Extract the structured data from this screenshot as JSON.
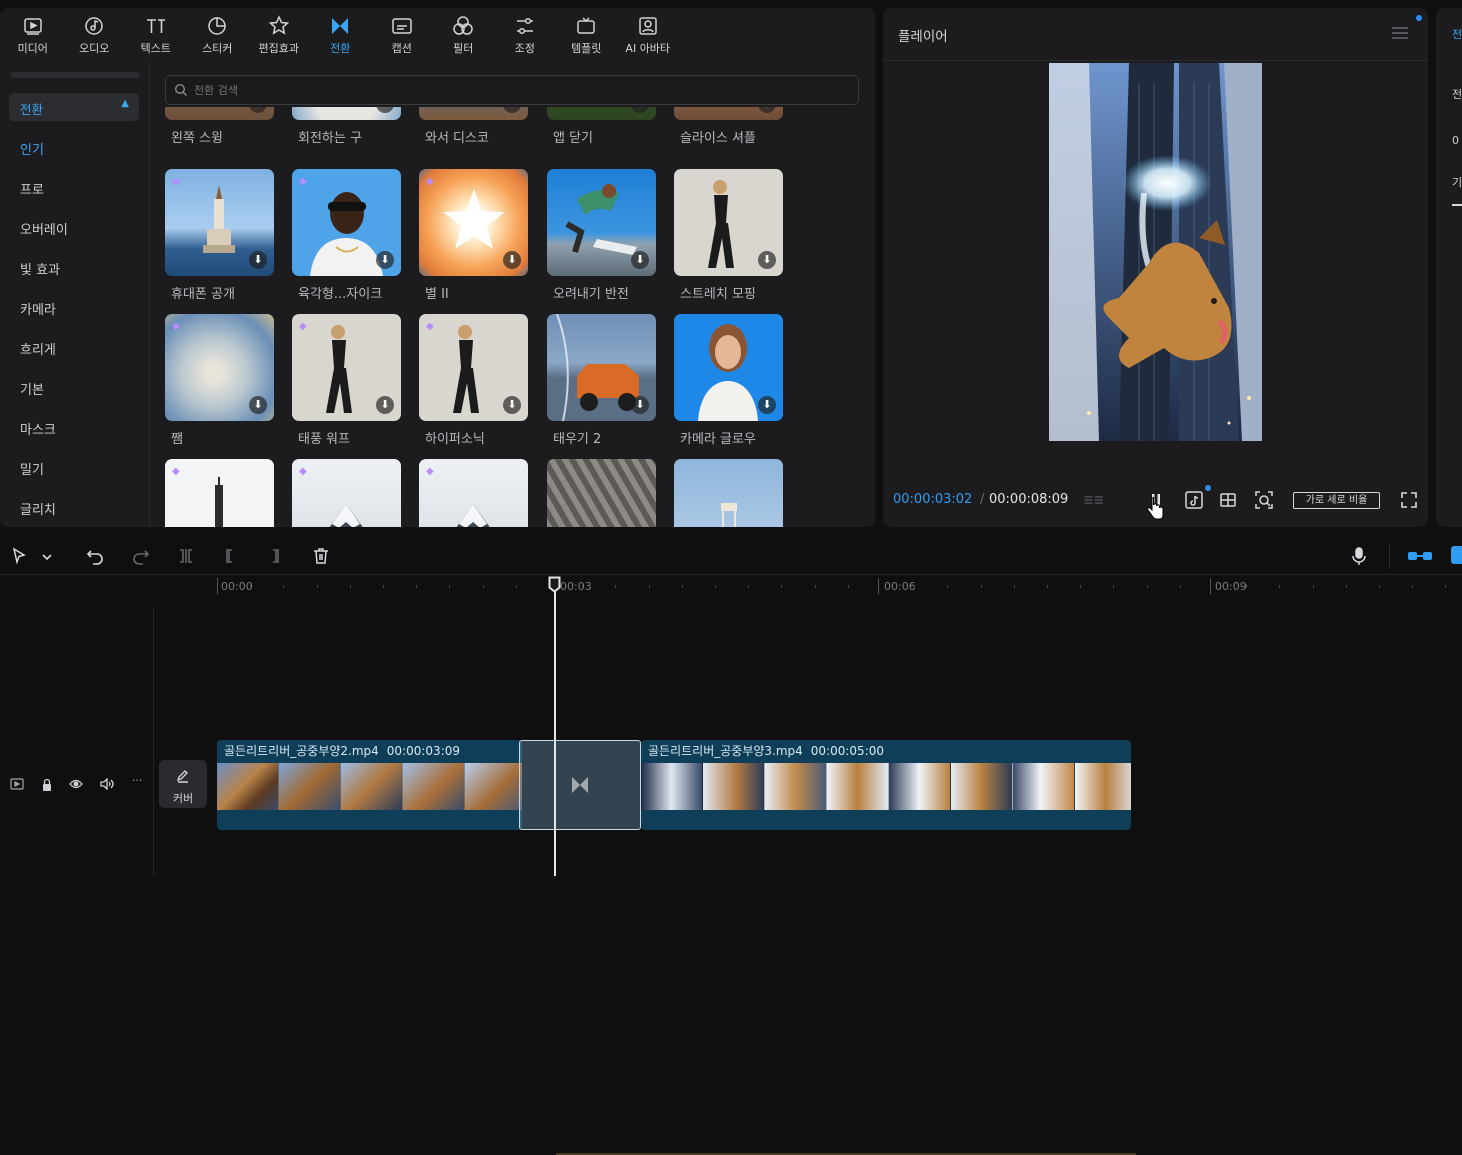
{
  "toolbar": {
    "items": [
      {
        "label": "미디어",
        "icon": "media-icon"
      },
      {
        "label": "오디오",
        "icon": "audio-icon"
      },
      {
        "label": "텍스트",
        "icon": "text-icon"
      },
      {
        "label": "스티커",
        "icon": "sticker-icon"
      },
      {
        "label": "편집효과",
        "icon": "effects-icon"
      },
      {
        "label": "전환",
        "icon": "transition-icon",
        "active": true
      },
      {
        "label": "캡션",
        "icon": "caption-icon"
      },
      {
        "label": "필터",
        "icon": "filter-icon"
      },
      {
        "label": "조정",
        "icon": "adjust-icon"
      },
      {
        "label": "템플릿",
        "icon": "template-icon"
      },
      {
        "label": "AI 아바타",
        "icon": "ai-avatar-icon"
      }
    ]
  },
  "sidebar": {
    "category": "전환",
    "items": [
      "인기",
      "프로",
      "오버레이",
      "빛 효과",
      "카메라",
      "흐리게",
      "기본",
      "마스크",
      "밀기",
      "글리치"
    ],
    "active_item": "인기"
  },
  "search": {
    "placeholder": "전환 검색"
  },
  "transitions": {
    "row0": [
      "왼쪽 스윙",
      "회전하는 구",
      "와서 디스코",
      "앱 닫기",
      "슬라이스 셔플"
    ],
    "row1": [
      "휴대폰 공개",
      "육각형...자이크",
      "별 II",
      "오려내기 반전",
      "스트레치 모핑"
    ],
    "row2": [
      "쨈",
      "태풍 워프",
      "하이퍼소닉",
      "태우기 2",
      "카메라 글로우"
    ]
  },
  "player": {
    "title": "플레이어",
    "current_time": "00:00:03:02",
    "separator": "/",
    "total_time": "00:00:08:09",
    "ratio_label": "가로 세로 비율"
  },
  "right_panel": {
    "labels": [
      "전",
      "전",
      "0",
      "기"
    ]
  },
  "timeline": {
    "ruler": [
      "00:00",
      "00:03",
      "00:06",
      "00:09"
    ],
    "cover_label": "커버",
    "clips": [
      {
        "name": "골든리트리버_공중부양2.mp4",
        "duration": "00:00:03:09"
      },
      {
        "name": "골든리트리버_공중부양3.mp4",
        "duration": "00:00:05:00"
      }
    ]
  },
  "colors": {
    "accent": "#3aa6f5",
    "clip": "#0f3f58",
    "panel": "#1c1c1f"
  }
}
